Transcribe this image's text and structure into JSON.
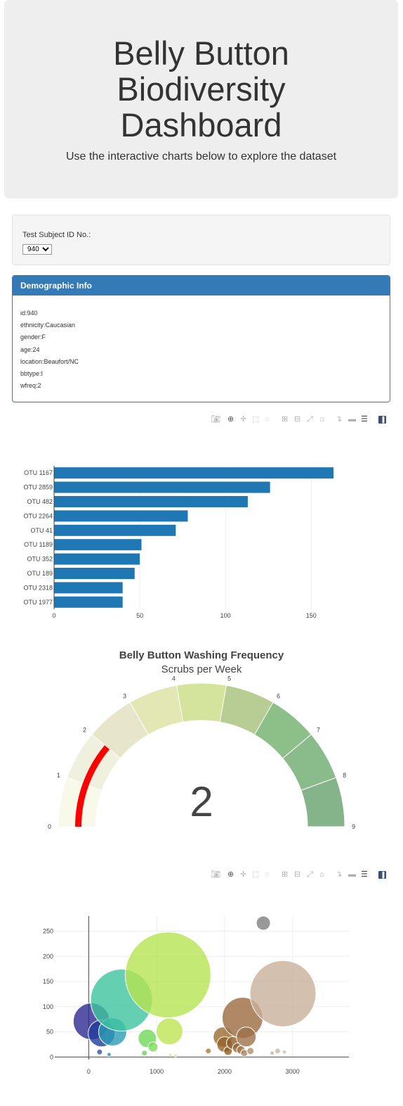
{
  "header": {
    "title_lines": [
      "Belly Button",
      "Biodiversity",
      "Dashboard"
    ],
    "subtitle": "Use the interactive charts below to explore the dataset"
  },
  "selector": {
    "label": "Test Subject ID No.:",
    "selected": "940"
  },
  "demographics": {
    "heading": "Demographic Info",
    "lines": [
      "id:940",
      "ethnicity:Caucasian",
      "gender:F",
      "age:24",
      "location:Beaufort/NC",
      "bbtype:I",
      "wfreq:2"
    ]
  },
  "modebar": {
    "icons": [
      "camera-icon",
      "zoom-icon",
      "pan-icon",
      "box-select-icon",
      "lasso-icon",
      "zoom-in-icon",
      "zoom-out-icon",
      "autoscale-icon",
      "reset-axes-icon",
      "spike-lines-icon",
      "hover-closest-icon",
      "hover-compare-icon",
      "plotly-logo-icon"
    ]
  },
  "chart_data": [
    {
      "type": "bar",
      "orientation": "horizontal",
      "categories": [
        "OTU 1167",
        "OTU 2859",
        "OTU 482",
        "OTU 2264",
        "OTU 41",
        "OTU 1189",
        "OTU 352",
        "OTU 189",
        "OTU 2318",
        "OTU 1977"
      ],
      "values": [
        163,
        126,
        113,
        78,
        71,
        51,
        50,
        47,
        40,
        40
      ],
      "xlim": [
        0,
        163
      ],
      "xticks": [
        0,
        50,
        100,
        150
      ],
      "color": "#1f77b4",
      "grid": true
    },
    {
      "type": "gauge",
      "title": "Belly Button Washing Frequency",
      "subtitle": "Scrubs per Week",
      "value": 2,
      "range": [
        0,
        9
      ],
      "ticks": [
        0,
        1,
        2,
        3,
        4,
        5,
        6,
        7,
        8,
        9
      ],
      "step_colors": [
        "#f8f9e9",
        "#f0f0df",
        "#e8e6ca",
        "#e3e7b3",
        "#d5e49d",
        "#b7cd93",
        "#8dbf89",
        "#8abb8b",
        "#85b48a"
      ],
      "needle_color": "#ff0000"
    },
    {
      "type": "scatter",
      "bubble": true,
      "xlim": [
        -500,
        3830
      ],
      "ylim": [
        -5,
        280
      ],
      "xticks": [
        0,
        1000,
        2000,
        3000
      ],
      "yticks": [
        0,
        50,
        100,
        150,
        200,
        250
      ],
      "grid": true,
      "points": [
        {
          "x": 41,
          "y": 71,
          "r": 26,
          "color": "#2e2a94"
        },
        {
          "x": 189,
          "y": 47,
          "r": 19,
          "color": "#1f3c9a"
        },
        {
          "x": 352,
          "y": 50,
          "r": 20,
          "color": "#2b9cb3"
        },
        {
          "x": 482,
          "y": 113,
          "r": 44,
          "color": "#3ec49d"
        },
        {
          "x": 160,
          "y": 10,
          "r": 4,
          "color": "#3152a8"
        },
        {
          "x": 300,
          "y": 5,
          "r": 3,
          "color": "#2f8cb4"
        },
        {
          "x": 862,
          "y": 37,
          "r": 13,
          "color": "#6fd85a"
        },
        {
          "x": 945,
          "y": 20,
          "r": 7,
          "color": "#7ddc55"
        },
        {
          "x": 820,
          "y": 8,
          "r": 4,
          "color": "#66d35c"
        },
        {
          "x": 1167,
          "y": 163,
          "r": 61,
          "color": "#b5e451"
        },
        {
          "x": 1189,
          "y": 51,
          "r": 19,
          "color": "#bde552"
        },
        {
          "x": 1200,
          "y": 4,
          "r": 2,
          "color": "#c6e659"
        },
        {
          "x": 1280,
          "y": 3,
          "r": 2,
          "color": "#cfe364"
        },
        {
          "x": 1760,
          "y": 12,
          "r": 4,
          "color": "#a27d37"
        },
        {
          "x": 1977,
          "y": 40,
          "r": 14,
          "color": "#9b6a2e"
        },
        {
          "x": 2000,
          "y": 25,
          "r": 11,
          "color": "#966328"
        },
        {
          "x": 2050,
          "y": 12,
          "r": 6,
          "color": "#8e5d25"
        },
        {
          "x": 2120,
          "y": 28,
          "r": 9,
          "color": "#90602a"
        },
        {
          "x": 2190,
          "y": 18,
          "r": 7,
          "color": "#97683a"
        },
        {
          "x": 2264,
          "y": 78,
          "r": 29,
          "color": "#9b6a40"
        },
        {
          "x": 2318,
          "y": 40,
          "r": 14,
          "color": "#9e7248"
        },
        {
          "x": 2240,
          "y": 14,
          "r": 6,
          "color": "#a57d53"
        },
        {
          "x": 2290,
          "y": 8,
          "r": 5,
          "color": "#aa8560"
        },
        {
          "x": 2380,
          "y": 12,
          "r": 5,
          "color": "#b08e6c"
        },
        {
          "x": 2570,
          "y": 266,
          "r": 10,
          "color": "#808080"
        },
        {
          "x": 2859,
          "y": 126,
          "r": 47,
          "color": "#c9b09a"
        },
        {
          "x": 2700,
          "y": 8,
          "r": 3,
          "color": "#c8b4a2"
        },
        {
          "x": 2780,
          "y": 12,
          "r": 4,
          "color": "#cbb8a6"
        },
        {
          "x": 2880,
          "y": 10,
          "r": 3,
          "color": "#d1bfb0"
        }
      ]
    }
  ]
}
